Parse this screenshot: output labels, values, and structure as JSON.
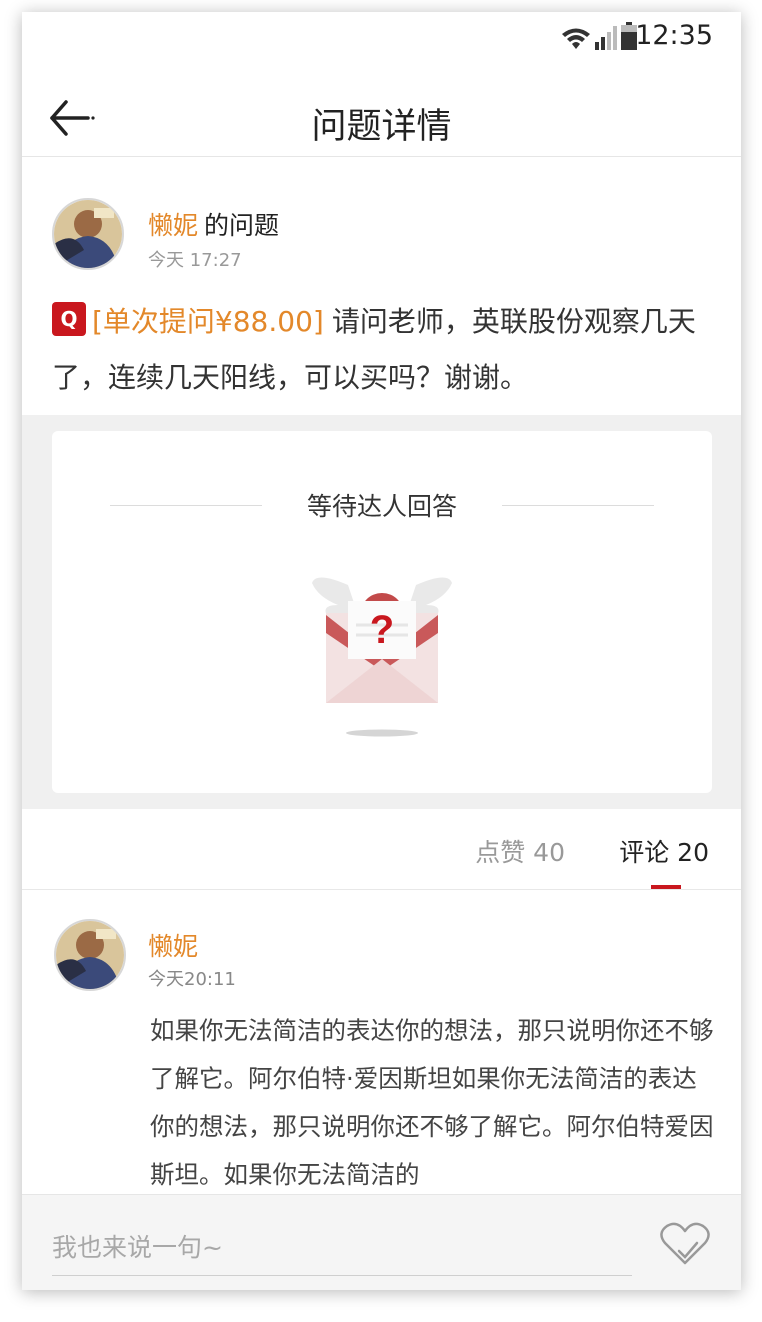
{
  "status_bar": {
    "time": "12:35",
    "icons": [
      "wifi-icon",
      "signal-icon",
      "battery-icon"
    ]
  },
  "nav": {
    "title": "问题详情",
    "back_icon": "arrow-left-icon"
  },
  "question": {
    "username": "懒妮",
    "suffix": "的问题",
    "time": "今天 17:27",
    "badge": "Q",
    "price": "[单次提问¥88.00]",
    "text": "请问老师，英联股份观察几天了，连续几天阳线，可以买吗？谢谢。"
  },
  "answer": {
    "waiting_text": "等待达人回答",
    "illustration_icon": "waiting-envelope-icon"
  },
  "tabs": [
    {
      "label": "点赞 40",
      "active": false
    },
    {
      "label": "评论 20",
      "active": true
    }
  ],
  "comment": {
    "username": "懒妮",
    "time": "今天20:11",
    "text": "如果你无法简洁的表达你的想法，那只说明你还不够了解它。阿尔伯特·爱因斯坦如果你无法简洁的表达你的想法，那只说明你还不够了解它。阿尔伯特爱因斯坦。如果你无法简洁的"
  },
  "input_bar": {
    "placeholder": "我也来说一句~",
    "like_icon": "heart-icon"
  },
  "colors": {
    "accent": "#c9171e",
    "username": "#e3882a",
    "background": "#f0f0f0"
  }
}
